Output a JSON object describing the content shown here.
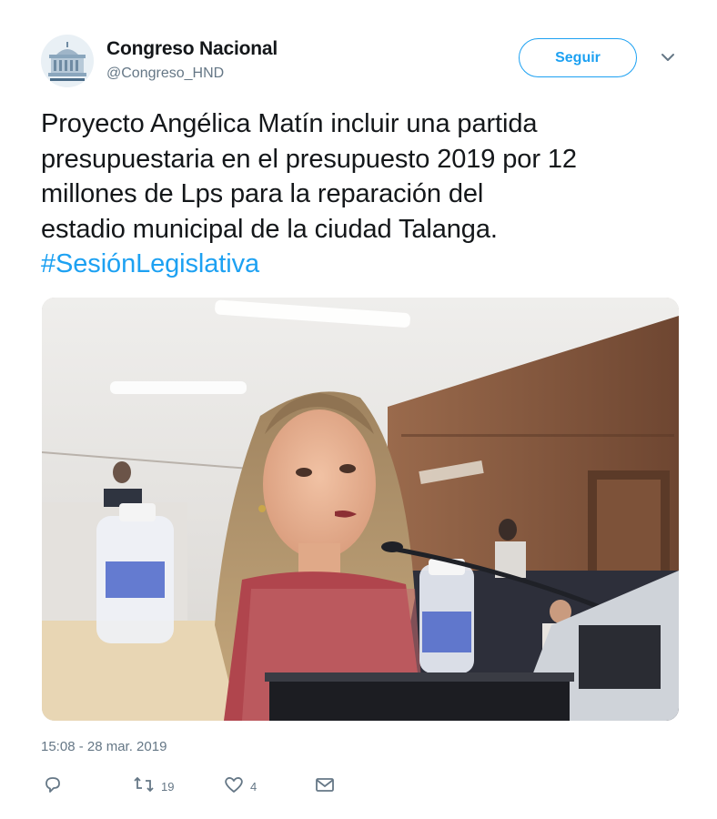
{
  "tweet": {
    "author": {
      "display_name": "Congreso Nacional",
      "handle": "@Congreso_HND",
      "avatar_icon": "congress-logo"
    },
    "follow_label": "Seguir",
    "text_lines": [
      "Proyecto Angélica Matín incluir una partida",
      "presupuestaria en el presupuesto 2019 por 12",
      "millones de Lps para la reparación  del",
      "estadio municipal de la ciudad Talanga."
    ],
    "hashtag": "#SesiónLegislativa",
    "media": {
      "description_icon": "photo-woman-speaking-at-microphone"
    },
    "timestamp": "15:08 - 28 mar. 2019",
    "actions": {
      "reply_icon": "reply-icon",
      "retweet_count": "19",
      "like_count": "4",
      "dm_icon": "envelope-icon"
    }
  },
  "colors": {
    "accent": "#1da1f2",
    "text": "#14171a",
    "muted": "#657786"
  }
}
